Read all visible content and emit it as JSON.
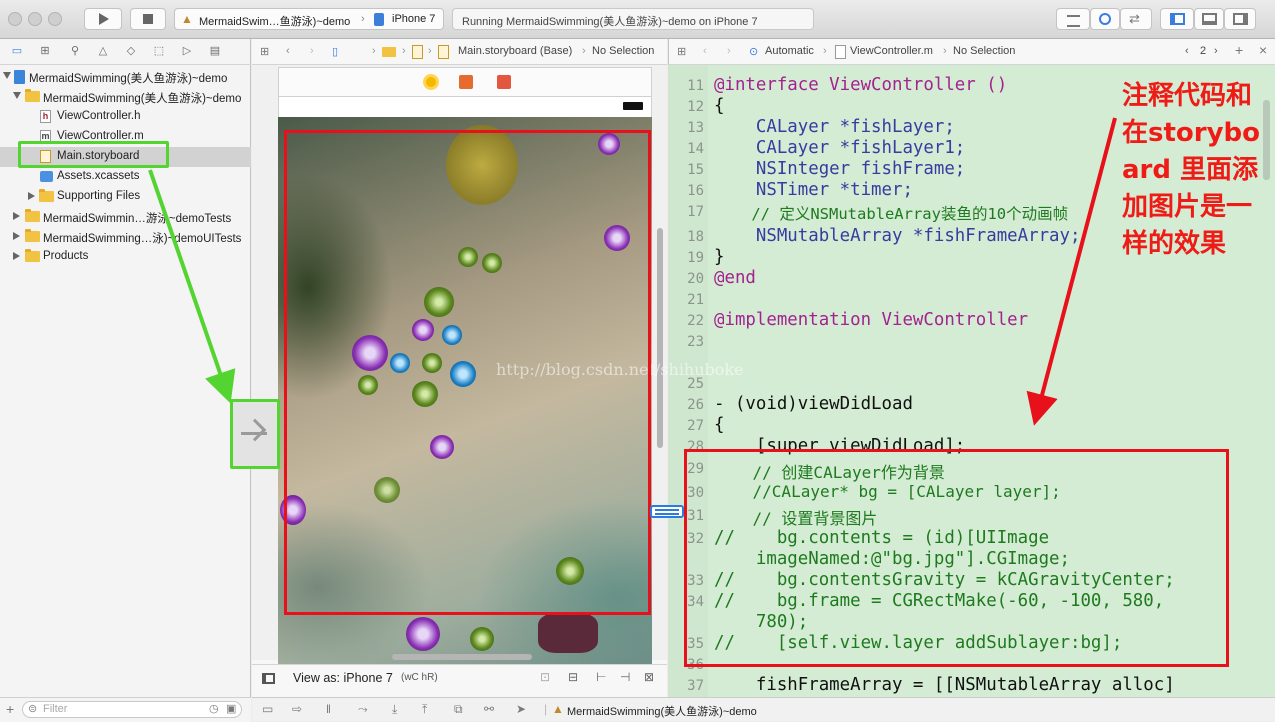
{
  "toolbar": {
    "scheme_name": "MermaidSwim…鱼游泳)~demo",
    "device": "iPhone 7",
    "activity_status": "Running MermaidSwimming(美人鱼游泳)~demo on iPhone 7"
  },
  "navigator": {
    "items": [
      {
        "label": "MermaidSwimming(美人鱼游泳)~demo",
        "kind": "project"
      },
      {
        "label": "MermaidSwimming(美人鱼游泳)~demo",
        "kind": "folder"
      },
      {
        "label": "ViewController.h",
        "kind": "header"
      },
      {
        "label": "ViewController.m",
        "kind": "source"
      },
      {
        "label": "Main.storyboard",
        "kind": "storyboard",
        "selected": true
      },
      {
        "label": "Assets.xcassets",
        "kind": "assets"
      },
      {
        "label": "Supporting Files",
        "kind": "folder"
      },
      {
        "label": "MermaidSwimmin…游泳~demoTests",
        "kind": "folder"
      },
      {
        "label": "MermaidSwimming…泳)~demoUITests",
        "kind": "folder"
      },
      {
        "label": "Products",
        "kind": "folder"
      }
    ],
    "filter_placeholder": "Filter"
  },
  "ib": {
    "jumpbar_file": "Main.storyboard (Base)",
    "jumpbar_selection": "No Selection",
    "view_as": "View as: iPhone 7",
    "size_class": "(wC hR)"
  },
  "code_editor": {
    "jumpbar_mode": "Automatic",
    "jumpbar_file": "ViewController.m",
    "jumpbar_selection": "No Selection",
    "counterpart_count": "2",
    "lines": [
      {
        "n": "11",
        "text": "@interface ViewController ()"
      },
      {
        "n": "12",
        "text": "{"
      },
      {
        "n": "13",
        "text": "    CALayer *fishLayer;"
      },
      {
        "n": "14",
        "text": "    CALayer *fishLayer1;"
      },
      {
        "n": "15",
        "text": "    NSInteger fishFrame;"
      },
      {
        "n": "16",
        "text": "    NSTimer *timer;"
      },
      {
        "n": "17",
        "text": "    // 定义NSMutableArray装鱼的10个动画帧"
      },
      {
        "n": "18",
        "text": "    NSMutableArray *fishFrameArray;"
      },
      {
        "n": "19",
        "text": "}"
      },
      {
        "n": "20",
        "text": "@end"
      },
      {
        "n": "21",
        "text": ""
      },
      {
        "n": "22",
        "text": "@implementation ViewController"
      },
      {
        "n": "23",
        "text": ""
      },
      {
        "n": "25",
        "text": ""
      },
      {
        "n": "26",
        "text": "- (void)viewDidLoad"
      },
      {
        "n": "27",
        "text": "{"
      },
      {
        "n": "28",
        "text": "    [super viewDidLoad];"
      },
      {
        "n": "29",
        "text": "    // 创建CALayer作为背景"
      },
      {
        "n": "30",
        "text": "    //CALayer* bg = [CALayer layer];"
      },
      {
        "n": "31",
        "text": "    // 设置背景图片"
      },
      {
        "n": "32",
        "text": "//    bg.contents = (id)[UIImage"
      },
      {
        "n": "",
        "text": "    imageNamed:@\"bg.jpg\"].CGImage;"
      },
      {
        "n": "33",
        "text": "//    bg.contentsGravity = kCAGravityCenter;"
      },
      {
        "n": "34",
        "text": "//    bg.frame = CGRectMake(-60, -100, 580,"
      },
      {
        "n": "",
        "text": "    780);"
      },
      {
        "n": "35",
        "text": "//    [self.view.layer addSublayer:bg];"
      },
      {
        "n": "36",
        "text": ""
      },
      {
        "n": "37",
        "text": "    fishFrameArray = [[NSMutableArray alloc]"
      }
    ]
  },
  "annotation": {
    "text": "注释代码和在storyboard 里面添加图片是一样的效果",
    "color": "#ef1b16"
  },
  "watermark": "http://blog.csdn.net/shihuboke",
  "debug_bar": {
    "target": "MermaidSwimming(美人鱼游泳)~demo"
  },
  "colors": {
    "selection_green": "#54d431",
    "annotation_red": "#e8101a",
    "code_background": "#d4ecd4"
  }
}
